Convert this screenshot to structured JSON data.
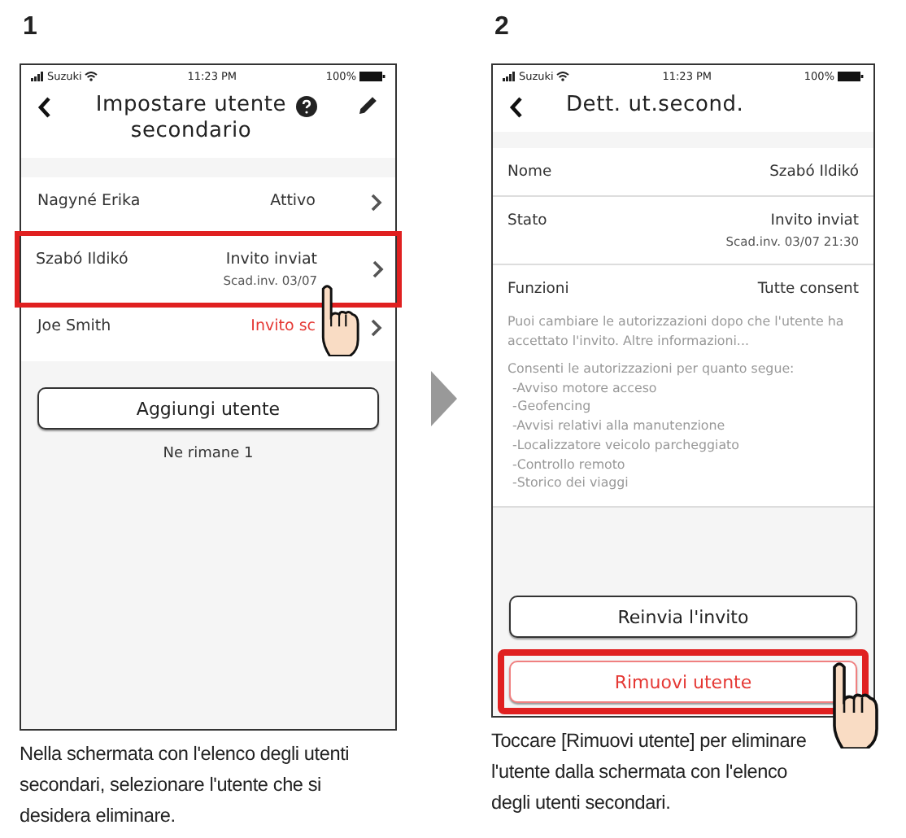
{
  "steps": [
    {
      "kind": "list",
      "number": "1",
      "status": {
        "carrier": "Suzuki",
        "time": "11:23 PM",
        "battery": "100%"
      },
      "title": "Impostare utente secondario",
      "users": [
        {
          "name": "Nagyné Erika",
          "status": "Attivo",
          "alert": false,
          "highlighted": false
        },
        {
          "name": "Szabó Ildikó",
          "status": "Invito inviat",
          "note": "Scad.inv. 03/07",
          "alert": false,
          "highlighted": true
        },
        {
          "name": "Joe Smith",
          "status": "Invito sc",
          "alert": true,
          "highlighted": false
        }
      ],
      "add_button": "Aggiungi utente",
      "remaining": "Ne rimane 1",
      "caption": "Nella schermata con l'elenco degli utenti secondari, selezionare l'utente che si desidera eliminare."
    },
    {
      "kind": "detail",
      "number": "2",
      "status": {
        "carrier": "Suzuki",
        "time": "11:23 PM",
        "battery": "100%"
      },
      "title": "Dett. ut.second.",
      "rows": [
        {
          "label": "Nome",
          "value": "Szabó Ildikó"
        },
        {
          "label": "Stato",
          "value": "Invito inviat",
          "note": "Scad.inv. 03/07 21:30"
        },
        {
          "label": "Funzioni",
          "value": "Tutte consent"
        }
      ],
      "description": "Puoi cambiare le autorizzazioni dopo che l'utente ha accettato l'invito. Altre informazioni...",
      "permissions_heading": "Consenti le autorizzazioni per quanto segue:",
      "permissions": [
        "-Avviso motore acceso",
        "-Geofencing",
        "-Avvisi relativi alla manutenzione",
        "-Localizzatore veicolo parcheggiato",
        "-Controllo remoto",
        "-Storico dei viaggi"
      ],
      "buttons": [
        {
          "label": "Reinvia l'invito",
          "kind": "default",
          "highlighted": false
        },
        {
          "label": "Rimuovi utente",
          "kind": "danger",
          "highlighted": true
        }
      ],
      "caption": "Toccare [Rimuovi utente] per eliminare l'utente dalla schermata con l'elenco degli utenti secondari."
    }
  ]
}
